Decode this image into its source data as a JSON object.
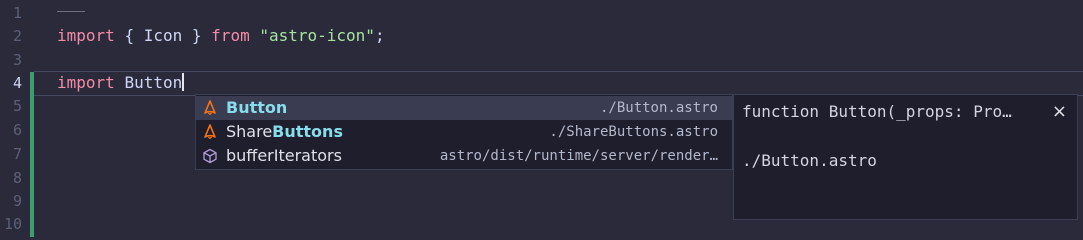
{
  "editor": {
    "line_numbers": [
      "1",
      "2",
      "3",
      "4",
      "5",
      "6",
      "7",
      "8",
      "9",
      "10"
    ],
    "line2": {
      "kw_import": "import",
      "brace_open": "{",
      "ident": "Icon",
      "brace_close": "}",
      "kw_from": "from",
      "string": "\"astro-icon\"",
      "semi": ";"
    },
    "line4": {
      "kw_import": "import",
      "ident": "Button"
    }
  },
  "suggestions": [
    {
      "icon": "astro-icon",
      "label_highlight_prefix": "",
      "label_highlight": "Button",
      "label_rest": "",
      "detail": "./Button.astro"
    },
    {
      "icon": "astro-icon",
      "label_prefix": "Share",
      "label_highlight": "Buttons",
      "label_rest": "",
      "detail": "./ShareButtons.astro"
    },
    {
      "icon": "cube-icon",
      "label": "bufferIterators",
      "detail": "astro/dist/runtime/server/render…"
    }
  ],
  "docs": {
    "signature": "function Button(_props: Pro…",
    "close": "×",
    "body": "./Button.astro"
  },
  "colors": {
    "keyword": "#f38ba8",
    "string": "#a6e3a1",
    "match_highlight": "#89dceb",
    "git_added": "#3a9e6e",
    "astro_icon": "#f97316",
    "cube_icon": "#b39ddb"
  }
}
